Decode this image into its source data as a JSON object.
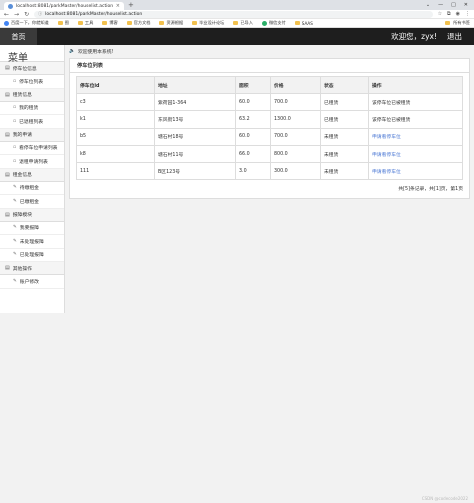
{
  "browser": {
    "tab_title": "localhost:8081/parkMaster/houselist.action",
    "url": "localhost:8081/parkMaster/houselist.action",
    "bookmarks": [
      "百度一下，你就知道",
      "图",
      "工具",
      "博客",
      "官方文档",
      "资源根据",
      "毕业设计论坛",
      "已导入",
      "微信支付",
      "SAAS"
    ],
    "bookmark_right": "所有书签"
  },
  "appbar": {
    "home": "首页",
    "greeting": "欢迎您，zyx!",
    "logout": "退出"
  },
  "sidebar": {
    "title": "菜单",
    "sections": [
      {
        "label": "停车位信息",
        "items": [
          "停车位列表"
        ]
      },
      {
        "label": "租赁信息",
        "items": [
          "我的租赁",
          "已退租列表"
        ]
      },
      {
        "label": "我的申请",
        "items": [
          "看停车位申请列表",
          "退租申请列表"
        ]
      },
      {
        "label": "租金信息",
        "items": [
          "待缴租金",
          "已缴租金"
        ]
      },
      {
        "label": "报障模块",
        "items": [
          "我要报障",
          "未处理报障",
          "已处理报障"
        ]
      },
      {
        "label": "其他操作",
        "items": [
          "账户修改"
        ]
      }
    ]
  },
  "content": {
    "welcome": "欢迎使用本系统!",
    "panel_title": "停车位列表",
    "columns": [
      "停车位id",
      "地址",
      "面积",
      "价格",
      "状态",
      "操作"
    ],
    "rows": [
      [
        "c3",
        "紫荷园1-364",
        "60.0",
        "700.0",
        "已租赁",
        "该停车位已被租赁"
      ],
      [
        "k1",
        "东风街13号",
        "63.2",
        "1300.0",
        "已租赁",
        "该停车位已被租赁"
      ],
      [
        "b5",
        "塘石村18号",
        "60.0",
        "700.0",
        "未租赁",
        "申请看停车位"
      ],
      [
        "k8",
        "塘石村11号",
        "66.0",
        "800.0",
        "未租赁",
        "申请看停车位"
      ],
      [
        "111",
        "B区123号",
        "3.0",
        "300.0",
        "未租赁",
        "申请看停车位"
      ]
    ],
    "pager": "共[5]条记录，共[1]页，第1页"
  },
  "watermark": "CSDN @codecode2022"
}
